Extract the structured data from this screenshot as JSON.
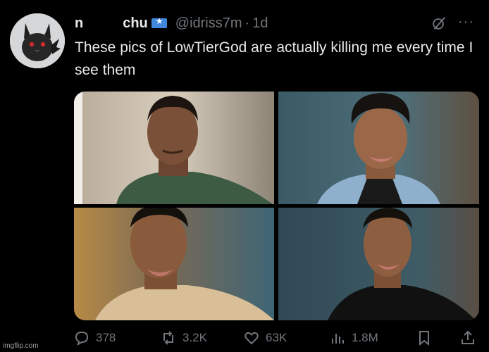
{
  "author": {
    "name_start": "n",
    "name_end": "chu",
    "flag_icon": "somalia-flag-icon",
    "handle": "@idriss7m",
    "separator": "·",
    "time": "1d",
    "avatar": "pikachu-dark-avatar"
  },
  "tweet": {
    "text": "These pics of LowTierGod are actually killing me every time I see them"
  },
  "media": {
    "photos": [
      "photo-man-green-shirt",
      "photo-man-denim-jacket",
      "photo-man-beige-shirt",
      "photo-man-black-shirt"
    ]
  },
  "actions": {
    "replies": "378",
    "reposts": "3.2K",
    "likes": "63K",
    "views": "1.8M"
  },
  "header_icons": {
    "grok": "grok-icon",
    "more": "···"
  },
  "watermark": "imgflip.com",
  "colors": {
    "background": "#000000",
    "text": "#e7e9ea",
    "muted": "#71767b"
  }
}
